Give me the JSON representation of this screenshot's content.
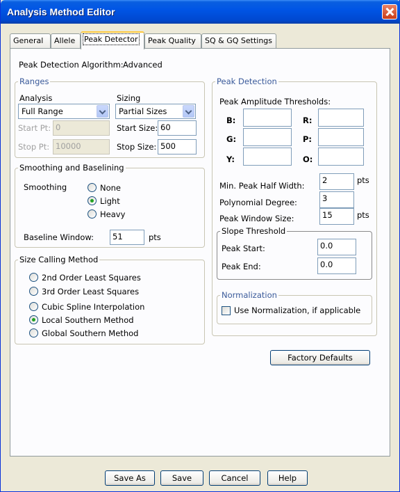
{
  "window": {
    "title": "Analysis Method Editor"
  },
  "tabs": [
    "General",
    "Allele",
    "Peak Detector",
    "Peak Quality",
    "SQ & GQ Settings"
  ],
  "algorithm": {
    "label": "Peak Detection Algorithm:",
    "value": "Advanced"
  },
  "ranges": {
    "title": "Ranges",
    "analysis_label": "Analysis",
    "analysis_value": "Full Range",
    "start_pt_label": "Start Pt:",
    "start_pt_value": "0",
    "stop_pt_label": "Stop Pt:",
    "stop_pt_value": "10000",
    "sizing_label": "Sizing",
    "sizing_value": "Partial Sizes",
    "start_size_label": "Start Size:",
    "start_size_value": "60",
    "stop_size_label": "Stop Size:",
    "stop_size_value": "500"
  },
  "smoothing": {
    "title": "Smoothing and Baselining",
    "smoothing_label": "Smoothing",
    "options": [
      "None",
      "Light",
      "Heavy"
    ],
    "selected": "Light",
    "baseline_label": "Baseline Window:",
    "baseline_value": "51",
    "baseline_unit": "pts"
  },
  "size_calling": {
    "title": "Size Calling Method",
    "options": [
      "2nd Order Least Squares",
      "3rd Order Least Squares",
      "Cubic Spline Interpolation",
      "Local Southern Method",
      "Global Southern Method"
    ],
    "selected": "Local Southern Method"
  },
  "peak_detection": {
    "title": "Peak Detection",
    "thresholds_label": "Peak Amplitude Thresholds:",
    "thresholds": [
      {
        "label": "B:",
        "value": ""
      },
      {
        "label": "R:",
        "value": ""
      },
      {
        "label": "G:",
        "value": ""
      },
      {
        "label": "P:",
        "value": ""
      },
      {
        "label": "Y:",
        "value": ""
      },
      {
        "label": "O:",
        "value": ""
      }
    ],
    "half_width_label": "Min. Peak Half Width:",
    "half_width_value": "2",
    "half_width_unit": "pts",
    "poly_label": "Polynomial Degree:",
    "poly_value": "3",
    "window_label": "Peak Window Size:",
    "window_value": "15",
    "window_unit": "pts"
  },
  "slope": {
    "title": "Slope Threshold",
    "start_label": "Peak Start:",
    "start_value": "0.0",
    "end_label": "Peak End:",
    "end_value": "0.0"
  },
  "normalization": {
    "title": "Normalization",
    "checkbox_label": "Use Normalization, if applicable",
    "checked": false
  },
  "buttons": {
    "factory_defaults": "Factory Defaults",
    "save_as": "Save As",
    "save": "Save",
    "cancel": "Cancel",
    "help": "Help"
  }
}
